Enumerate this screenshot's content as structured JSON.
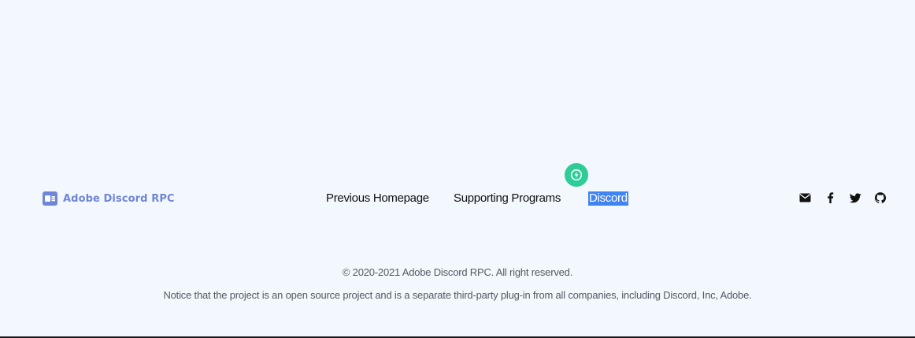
{
  "brand": {
    "name": "Adobe Discord RPC",
    "icon": "adobe-discord-rpc-logo-icon",
    "color": "#6f86d6"
  },
  "nav": {
    "items": [
      {
        "label": "Previous Homepage"
      },
      {
        "label": "Supporting Programs"
      },
      {
        "label": "Discord",
        "selected": true
      }
    ],
    "badge_icon": "discord-activity-icon",
    "badge_color": "#2ecc96",
    "highlight_color": "#3f84f2"
  },
  "social": {
    "icons": [
      "mail-icon",
      "facebook-icon",
      "twitter-icon",
      "github-icon"
    ]
  },
  "footer": {
    "copyright": "© 2020-2021 Adobe Discord RPC. All right reserved.",
    "notice": "Notice that the project is an open source project and is a separate third-party plug-in from all companies, including Discord, Inc, Adobe."
  },
  "colors": {
    "background": "#f3f7fe",
    "text": "#111111",
    "muted_text": "#555a63"
  }
}
